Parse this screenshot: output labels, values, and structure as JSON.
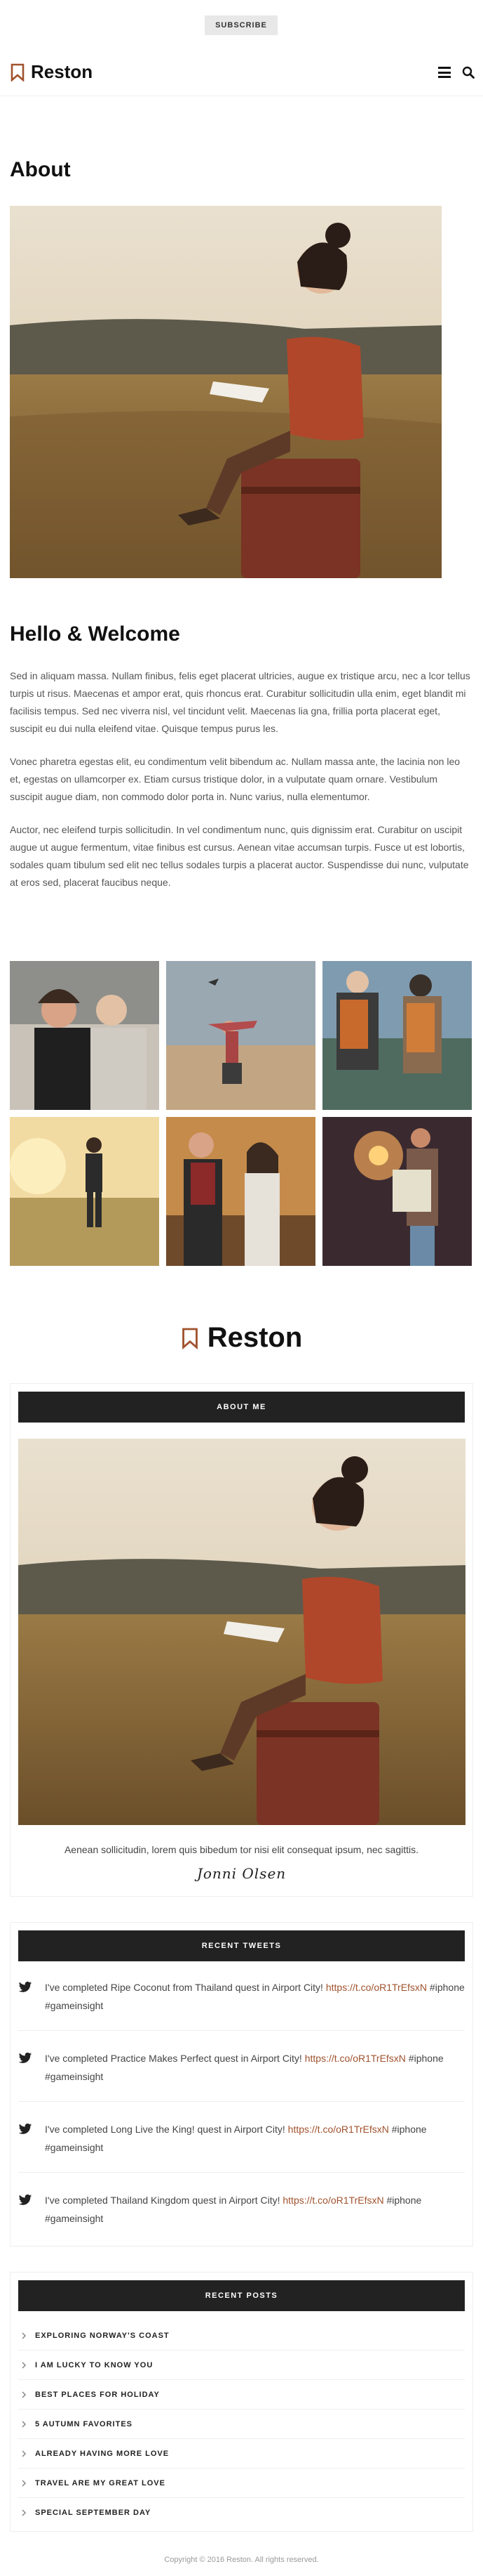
{
  "topbar": {
    "subscribe_label": "SUBSCRIBE"
  },
  "header": {
    "brand": "Reston"
  },
  "about": {
    "title": "About",
    "welcome_title": "Hello & Welcome",
    "paragraphs": [
      "Sed in aliquam massa. Nullam finibus, felis eget placerat ultricies, augue ex tristique arcu, nec a lcor tellus turpis ut risus. Maecenas et ampor erat, quis rhoncus erat. Curabitur sollicitudin ulla enim, eget blandit mi facilisis tempus. Sed nec viverra nisl, vel tincidunt velit. Maecenas lia gna, frillia porta placerat eget, suscipit eu dui nulla eleifend vitae. Quisque tempus purus les.",
      "Vonec pharetra egestas elit, eu condimentum velit bibendum ac. Nullam massa ante, the lacinia non leo et, egestas on ullamcorper ex. Etiam cursus tristique dolor, in a vulputate quam ornare. Vestibulum suscipit augue diam, non commodo dolor porta in. Nunc varius, nulla elementumor.",
      "Auctor, nec eleifend turpis sollicitudin. In vel condimentum nunc, quis dignissim erat. Curabitur on uscipit augue ut augue fermentum, vitae finibus est cursus. Aenean vitae accumsan turpis. Fusce ut est lobortis, sodales quam tibulum sed elit nec tellus sodales turpis a placerat auctor. Suspendisse dui nunc, vulputate at eros sed, placerat faucibus neque."
    ]
  },
  "footer_brand": "Reston",
  "about_widget": {
    "title": "ABOUT ME",
    "text": "Aenean sollicitudin, lorem quis bibedum tor nisi elit consequat ipsum, nec sagittis.",
    "signature": "Jonni Olsen"
  },
  "tweets_widget": {
    "title": "RECENT TWEETS",
    "tweets": [
      {
        "pre": "I've completed Ripe Coconut from Thailand quest in Airport City! ",
        "link": "https://t.co/oR1TrEfsxN",
        "post": " #iphone #gameinsight"
      },
      {
        "pre": "I've completed Practice Makes Perfect quest in Airport City! ",
        "link": "https://t.co/oR1TrEfsxN",
        "post": " #iphone #gameinsight"
      },
      {
        "pre": "I've completed Long Live the King! quest in Airport City! ",
        "link": "https://t.co/oR1TrEfsxN",
        "post": " #iphone #gameinsight"
      },
      {
        "pre": "I've completed Thailand Kingdom quest in Airport City! ",
        "link": "https://t.co/oR1TrEfsxN",
        "post": " #iphone #gameinsight"
      }
    ]
  },
  "posts_widget": {
    "title": "RECENT POSTS",
    "items": [
      "EXPLORING NORWAY'S COAST",
      "I AM LUCKY TO KNOW YOU",
      "BEST PLACES FOR HOLIDAY",
      "5 AUTUMN FAVORITES",
      "ALREADY HAVING MORE LOVE",
      "TRAVEL ARE MY GREAT LOVE",
      "SPECIAL SEPTEMBER DAY"
    ]
  },
  "footer": {
    "copyright": "Copyright © 2016 Reston. All rights reserved."
  },
  "colors": {
    "accent": "#a0522d",
    "dark": "#222222"
  }
}
